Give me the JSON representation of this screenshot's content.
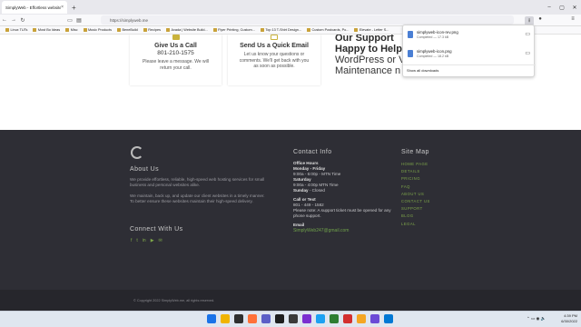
{
  "browser": {
    "tab_title": "SimplyWeb - Effortless website ma",
    "tab_close": "×",
    "new_tab": "+",
    "url": "https://simplyweb.me",
    "window_controls": [
      "–",
      "▢",
      "✕"
    ],
    "bookmarks": [
      "Linux TUTs",
      "Most Bo Ideas",
      "Misc",
      "Music Products",
      "BeneBuild",
      "Recipes",
      "Avada | Website Build...",
      "Flyer Printing, Custom...",
      "Top 13 T-Shirt Design...",
      "Custom Postcards, Po...",
      "Elevate - Letter S..."
    ]
  },
  "cards": [
    {
      "title": "Give Us a Call",
      "phone": "801-210-1575",
      "text": "Please leave a message. We will return your call."
    },
    {
      "title": "Send Us a Quick Email",
      "text": "Let us know your questions or comments. We'll get back with you as soon as possible."
    }
  ],
  "hero": {
    "line1": "Our Support",
    "line2": "Happy to Help",
    "line3": "WordPress or V",
    "line4": "Maintenance n"
  },
  "footer": {
    "about_title": "About Us",
    "about_p1": "We provide effortless, reliable, high-speed web hosting services for small business and personal websites alike.",
    "about_p2": "We maintain, back up, and update our client websites in a timely manner. To better ensure these websites maintain their high-speed delivery.",
    "connect_title": "Connect With Us",
    "social": [
      "f",
      "t",
      "in",
      "▶",
      "✉"
    ],
    "contact_title": "Contact Info",
    "office_hours": "Office Hours",
    "mon_fri_label": "Monday - Friday",
    "mon_fri": "9:00a - 6:00p - MTN Time",
    "saturday_label": "Saturday",
    "saturday": "9:00a - 4:00p MTN Time",
    "sunday_label": "Sunday",
    "sunday": "- Closed",
    "call_label": "Call or Text",
    "call_number": "801 - 449 - 1582",
    "note": "Please note: A support ticket must be opened for any phone support.",
    "email_label": "Email",
    "email": "SimplyWeb247@gmail.com",
    "sitemap_title": "Site Map",
    "sitemap": [
      "HOME PAGE",
      "DETAILS",
      "PRICING",
      "FAQ",
      "ABOUT US",
      "CONTACT US",
      "SUPPORT",
      "BLOG",
      "LEGAL"
    ],
    "copyright": "© Copyright 2022 SimplyWeb.me, all rights reserved."
  },
  "downloads": {
    "items": [
      {
        "name": "simplyweb-icon-rev.png",
        "status": "Completed — 17.3 kB"
      },
      {
        "name": "simplyweb-icon.png",
        "status": "Completed — 18.2 kB"
      }
    ],
    "show_all": "Show all downloads"
  },
  "taskbar": {
    "time": "4:39 PM",
    "date": "6/30/2022",
    "icon_colors": [
      "#1a73e8",
      "#f0b400",
      "#2f2f2f",
      "#ff7139",
      "#5b5fc7",
      "#1e1e1e",
      "#3a3a3a",
      "#7b2fd0",
      "#1da1f2",
      "#2e7d32",
      "#d32f2f",
      "#f5a623",
      "#6b4ad6",
      "#0078d4"
    ]
  }
}
